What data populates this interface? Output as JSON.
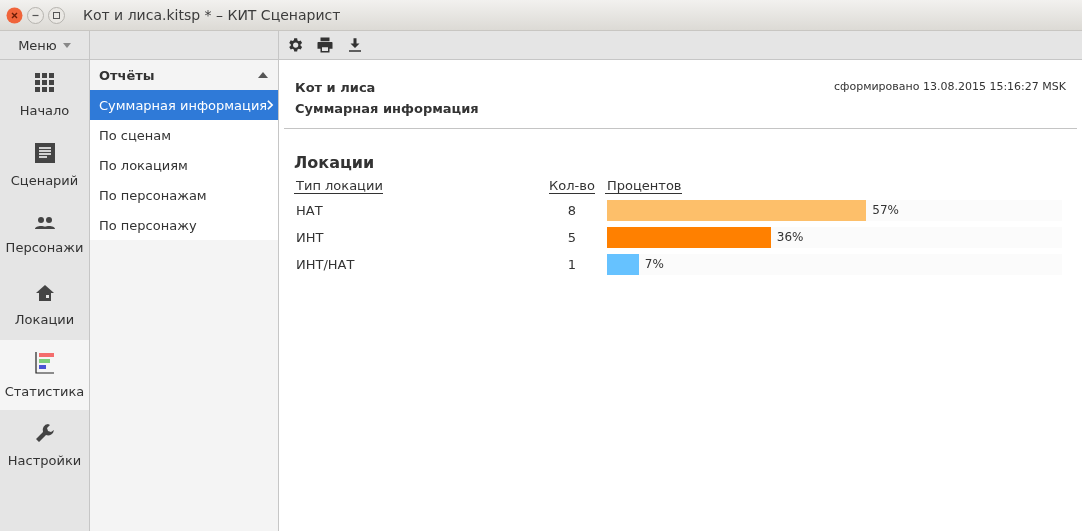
{
  "window": {
    "title": "Кот и лиса.kitsp * – КИТ Сценарист"
  },
  "menu": {
    "label": "Меню"
  },
  "nav": [
    {
      "label": "Начало",
      "selected": false
    },
    {
      "label": "Сценарий",
      "selected": false
    },
    {
      "label": "Персонажи",
      "selected": false
    },
    {
      "label": "Локации",
      "selected": false
    },
    {
      "label": "Статистика",
      "selected": true
    },
    {
      "label": "Настройки",
      "selected": false
    }
  ],
  "reports": {
    "title": "Отчёты",
    "expanded": true,
    "items": [
      {
        "label": "Суммарная информация",
        "selected": true
      },
      {
        "label": "По сценам",
        "selected": false
      },
      {
        "label": "По локациям",
        "selected": false
      },
      {
        "label": "По персонажам",
        "selected": false
      },
      {
        "label": "По персонажу",
        "selected": false
      }
    ]
  },
  "report": {
    "project": "Кот и лиса",
    "name": "Суммарная информация",
    "generated": "сформировано 13.08.2015 15:16:27 MSK",
    "section": "Локации",
    "columns": [
      "Тип локации",
      "Кол-во",
      "Процентов"
    ],
    "rows": [
      {
        "type": "НАТ",
        "count": "8",
        "level": 0.57,
        "color": "#fdbf6a",
        "percent": "57%"
      },
      {
        "type": "ИНТ",
        "count": "5",
        "level": 0.36,
        "color": "#ff8000",
        "percent": "36%"
      },
      {
        "type": "ИНТ/НАТ",
        "count": "1",
        "level": 0.07,
        "color": "#66c2ff",
        "percent": "7%"
      }
    ]
  }
}
